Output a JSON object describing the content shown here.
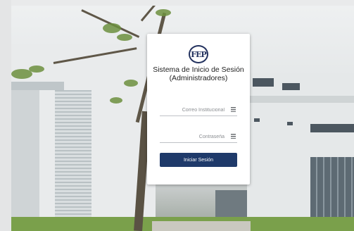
{
  "login": {
    "logo_text": "FEP",
    "title": "Sistema de Inicio de Sesión (Administradores)",
    "email_placeholder": "Correo Institucional",
    "password_placeholder": "Contraseña",
    "submit_label": "Iniciar Sesión"
  },
  "colors": {
    "button_bg": "#1f3a6a",
    "logo": "#23325f"
  },
  "icons": {
    "email_field_icon": "list-icon",
    "password_field_icon": "list-icon"
  }
}
